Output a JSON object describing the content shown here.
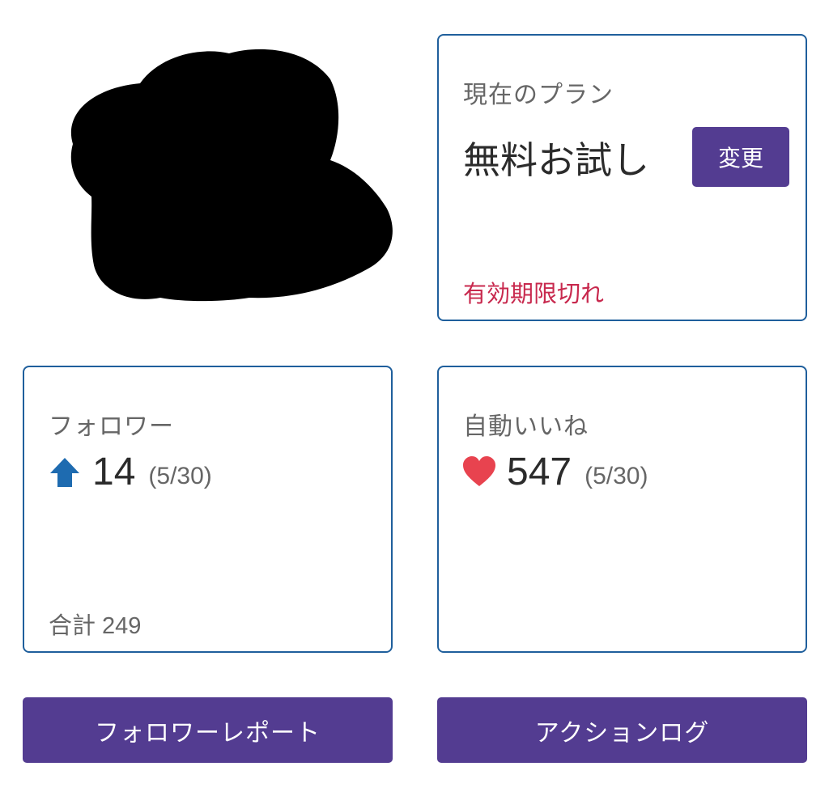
{
  "plan": {
    "label": "現在のプラン",
    "name": "無料お試し",
    "change_label": "変更",
    "status": "有効期限切れ"
  },
  "followers": {
    "label": "フォロワー",
    "icon": "arrow-up-icon",
    "value": "14",
    "date": "(5/30)",
    "total_label": "合計",
    "total_value": "249"
  },
  "likes": {
    "label": "自動いいね",
    "icon": "heart-icon",
    "value": "547",
    "date": "(5/30)"
  },
  "buttons": {
    "follower_report": "フォロワーレポート",
    "action_log": "アクションログ"
  },
  "colors": {
    "accent": "#533c91",
    "border": "#1f5f9c",
    "warning": "#c8294e",
    "arrow": "#1e6bb0",
    "heart": "#e8434f"
  }
}
